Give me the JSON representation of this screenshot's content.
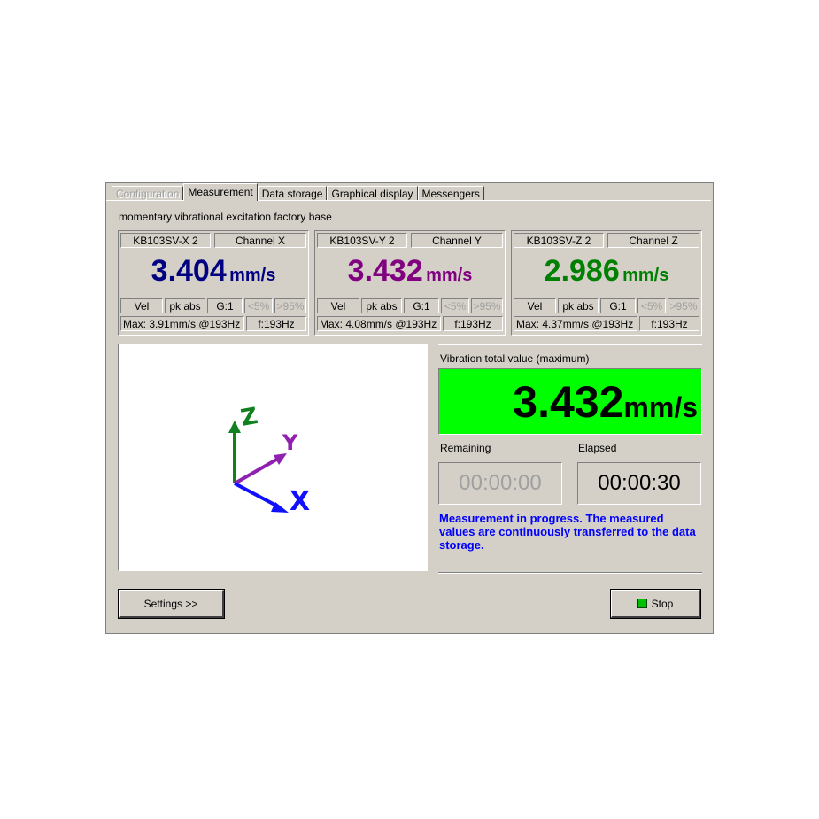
{
  "tabs": [
    {
      "label": "Configuration",
      "state": "disabled"
    },
    {
      "label": "Measurement",
      "state": "active"
    },
    {
      "label": "Data storage",
      "state": "normal"
    },
    {
      "label": "Graphical display",
      "state": "normal"
    },
    {
      "label": "Messengers",
      "state": "normal"
    }
  ],
  "panel_title": "momentary vibrational excitation factory  base",
  "channels": [
    {
      "sensor": "KB103SV-X 2",
      "channel": "Channel X",
      "value": "3.404",
      "unit": "mm/s",
      "color": "#000080",
      "mode": "Vel",
      "detect": "pk abs",
      "gain": "G:1",
      "low": "<5%",
      "high": ">95%",
      "max": "Max: 3.91mm/s @193Hz",
      "freq": "f:193Hz"
    },
    {
      "sensor": "KB103SV-Y 2",
      "channel": "Channel Y",
      "value": "3.432",
      "unit": "mm/s",
      "color": "#800080",
      "mode": "Vel",
      "detect": "pk abs",
      "gain": "G:1",
      "low": "<5%",
      "high": ">95%",
      "max": "Max: 4.08mm/s @193Hz",
      "freq": "f:193Hz"
    },
    {
      "sensor": "KB103SV-Z 2",
      "channel": "Channel Z",
      "value": "2.986",
      "unit": "mm/s",
      "color": "#008000",
      "mode": "Vel",
      "detect": "pk abs",
      "gain": "G:1",
      "low": "<5%",
      "high": ">95%",
      "max": "Max: 4.37mm/s @193Hz",
      "freq": "f:193Hz"
    }
  ],
  "axes": {
    "x_label": "X",
    "y_label": "Y",
    "z_label": "Z",
    "x_color": "#1010ff",
    "y_color": "#9020b0",
    "z_color": "#108020"
  },
  "total": {
    "label": "Vibration total value (maximum)",
    "value": "3.432",
    "unit": "mm/s",
    "background": "#00ff00"
  },
  "remaining": {
    "label": "Remaining",
    "value": "00:00:00"
  },
  "elapsed": {
    "label": "Elapsed",
    "value": "00:00:30"
  },
  "status_message": "Measurement in progress. The measured values are continuously transferred to the data storage.",
  "buttons": {
    "settings": "Settings >>",
    "stop": "Stop"
  }
}
